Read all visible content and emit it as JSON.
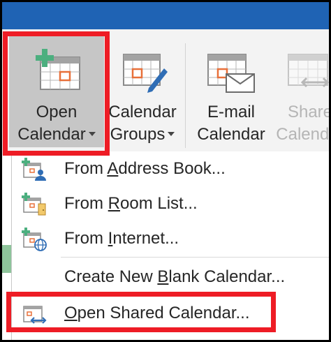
{
  "ribbon": {
    "open_calendar": {
      "line1": "Open",
      "line2": "Calendar"
    },
    "calendar_groups": {
      "line1": "Calendar",
      "line2": "Groups"
    },
    "email_calendar": {
      "line1": "E-mail",
      "line2": "Calendar"
    },
    "share_calendar": {
      "line1": "Share",
      "line2": "Calendar"
    }
  },
  "menu": {
    "items": [
      {
        "pre": "From ",
        "accel": "A",
        "post": "ddress Book...",
        "icon": "address-book-calendar-icon"
      },
      {
        "pre": "From ",
        "accel": "R",
        "post": "oom List...",
        "icon": "room-list-calendar-icon"
      },
      {
        "pre": "From ",
        "accel": "I",
        "post": "nternet...",
        "icon": "internet-calendar-icon"
      },
      {
        "pre": "Create New ",
        "accel": "B",
        "post": "lank Calendar...",
        "icon": ""
      },
      {
        "pre": "",
        "accel": "O",
        "post": "pen Shared Calendar...",
        "icon": "shared-calendar-icon"
      }
    ]
  },
  "colors": {
    "highlight": "#ee1c25",
    "ribbon_bar": "#1f63b4",
    "calendar_orange": "#e8703a",
    "add_green": "#4caf7f",
    "user_blue": "#2f6db5"
  }
}
